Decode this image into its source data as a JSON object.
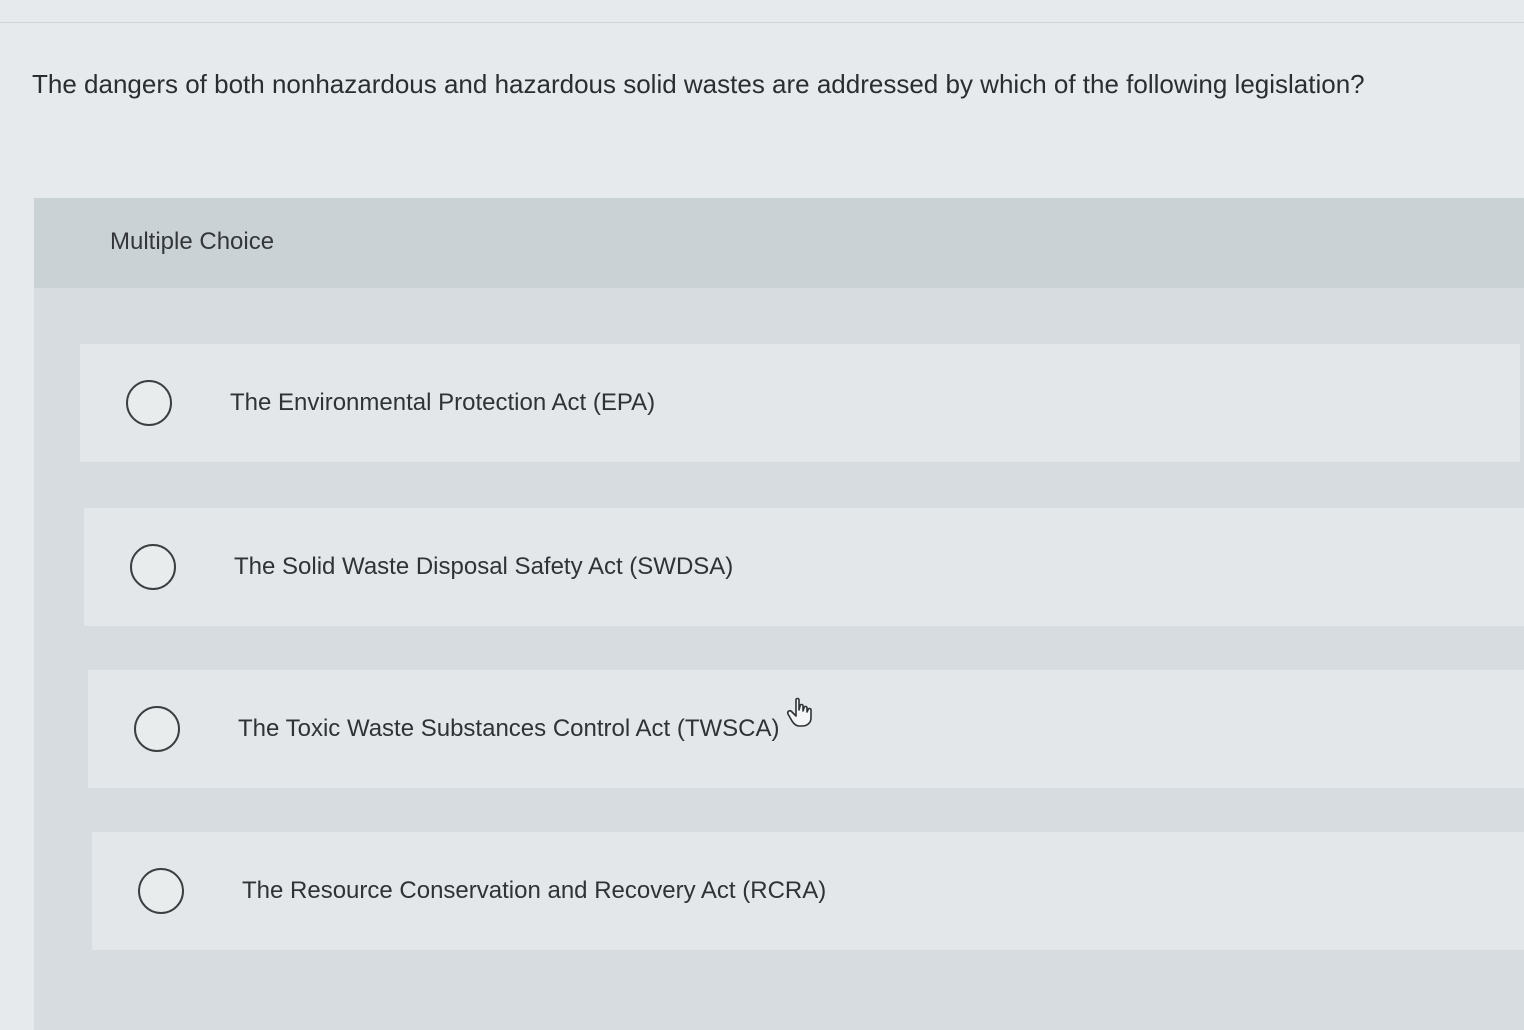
{
  "question": {
    "text": "The dangers of both nonhazardous and hazardous solid wastes are addressed by which of the following legislation?"
  },
  "panel": {
    "title": "Multiple Choice"
  },
  "options": [
    {
      "label": "The Environmental Protection Act (EPA)",
      "selected": false
    },
    {
      "label": "The Solid Waste Disposal Safety Act (SWDSA)",
      "selected": false
    },
    {
      "label": "The Toxic Waste Substances Control Act (TWSCA)",
      "selected": false
    },
    {
      "label": "The Resource Conservation and Recovery Act (RCRA)",
      "selected": false
    }
  ],
  "icons": {
    "cursor": "hand-pointer-icon",
    "radio": "radio-unselected-icon"
  },
  "colors": {
    "page_background": "#e6eaec",
    "panel_background": "#d6dcdf",
    "panel_header": "#cbd2d5",
    "option_background": "#e3e7e9",
    "text": "#2f3336"
  }
}
